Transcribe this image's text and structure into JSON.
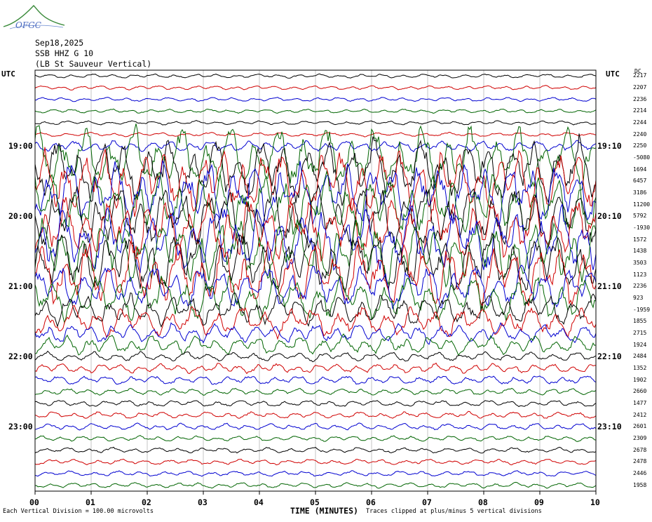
{
  "logo": {
    "text": "OFGC"
  },
  "header": {
    "date": "Sep18,2025",
    "station": "SSB HHZ G 10",
    "location": "(LB  St Sauveur Vertical)"
  },
  "utc_left": "UTC",
  "utc_right": "UTC",
  "dc_label": "DC",
  "footer": {
    "vertical_division": "Each Vertical Division =  100.00 microvolts",
    "x_title": "TIME (MINUTES)",
    "clip_note": "Traces clipped at plus/minus 5 vertical divisions"
  },
  "chart_data": {
    "type": "line",
    "title": "SSB HHZ G 10",
    "xlabel": "TIME (MINUTES)",
    "ylabel": "UTC",
    "xlim": [
      0,
      10
    ],
    "x_ticks": [
      "00",
      "01",
      "02",
      "03",
      "04",
      "05",
      "06",
      "07",
      "08",
      "09",
      "10"
    ],
    "grid": "vertical",
    "trace_colors": [
      "#000000",
      "#d00000",
      "#0000d0",
      "#006400"
    ],
    "left_hour_labels": [
      "19:00",
      "20:00",
      "21:00",
      "22:00",
      "23:00"
    ],
    "right_hour_labels": [
      "19:10",
      "20:10",
      "21:10",
      "22:10",
      "23:10"
    ],
    "dc_offsets": [
      "2217",
      "2207",
      "2236",
      "2214",
      "2244",
      "2240",
      "2250",
      "-5080",
      "1694",
      "6457",
      "3186",
      "11200",
      "5792",
      "-1930",
      "1572",
      "1438",
      "3503",
      "1123",
      "2236",
      "923",
      "-1959",
      "1855",
      "2715",
      "1924",
      "2484",
      "1352",
      "1902",
      "2660",
      "1477",
      "2412",
      "2601",
      "2309",
      "2678",
      "2478",
      "2446",
      "1958"
    ]
  }
}
